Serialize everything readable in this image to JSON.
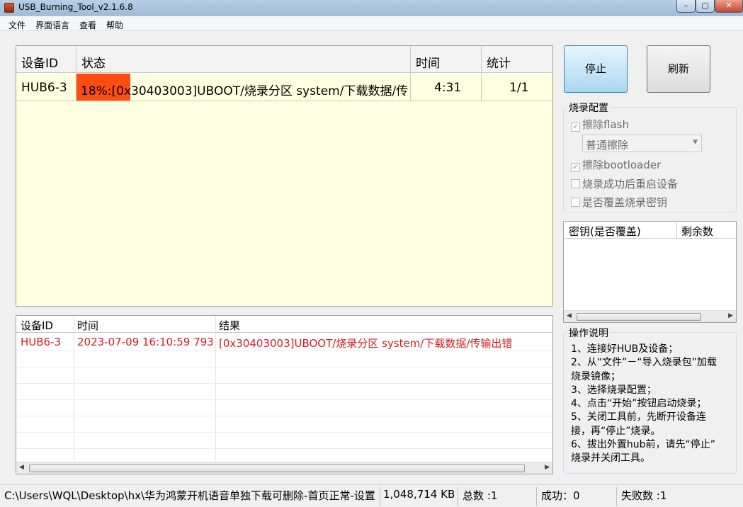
{
  "window": {
    "title": "USB_Burning_Tool_v2.1.6.8"
  },
  "menu": [
    "文件",
    "界面语言",
    "查看",
    "帮助"
  ],
  "device_table": {
    "headers": [
      "设备ID",
      "状态",
      "时间",
      "统计"
    ],
    "rows": [
      {
        "id": "HUB6-3",
        "status": "18%:[0x30403003]UBOOT/烧录分区 system/下载数据/传",
        "progress": 0.18,
        "time": "4:31",
        "stat": "1/1"
      }
    ]
  },
  "buttons": {
    "stop": "停止",
    "refresh": "刷新"
  },
  "burn_config": {
    "title": "烧录配置",
    "erase_flash": "擦除flash",
    "erase_mode": "普通擦除",
    "erase_bootloader": "擦除bootloader",
    "reboot_after": "烧录成功后重启设备",
    "overwrite_key": "是否覆盖烧录密钥"
  },
  "key_table": {
    "headers": [
      "密钥(是否覆盖)",
      "剩余数"
    ]
  },
  "log_table": {
    "headers": [
      "设备ID",
      "时间",
      "结果"
    ],
    "rows": [
      {
        "id": "HUB6-3",
        "time": "2023-07-09 16:10:59 793",
        "result": "[0x30403003]UBOOT/烧录分区 system/下载数据/传输出错"
      }
    ]
  },
  "instructions": {
    "title": "操作说明",
    "lines": [
      "1、连接好HUB及设备；",
      "2、从“文件”－“导入烧录包”加载",
      "烧录镜像；",
      "3、选择烧录配置；",
      "4、点击“开始”按钮启动烧录；",
      "5、关闭工具前，先断开设备连",
      "接，再“停止”烧录。",
      "6、拔出外置hub前，请先“停止”",
      "烧录并关闭工具。"
    ]
  },
  "status": {
    "path": "C:\\Users\\WQL\\Desktop\\hx\\华为鸿蒙开机语音单独下载可删除-首页正常-设置",
    "size": "1,048,714 KB",
    "total": "总数 :1",
    "success": "成功：0",
    "fail": "失败数 :1"
  },
  "colors": {
    "progress": "#ff4c10",
    "grid_bg": "#ffffe1",
    "error_text": "#d21e1e"
  }
}
